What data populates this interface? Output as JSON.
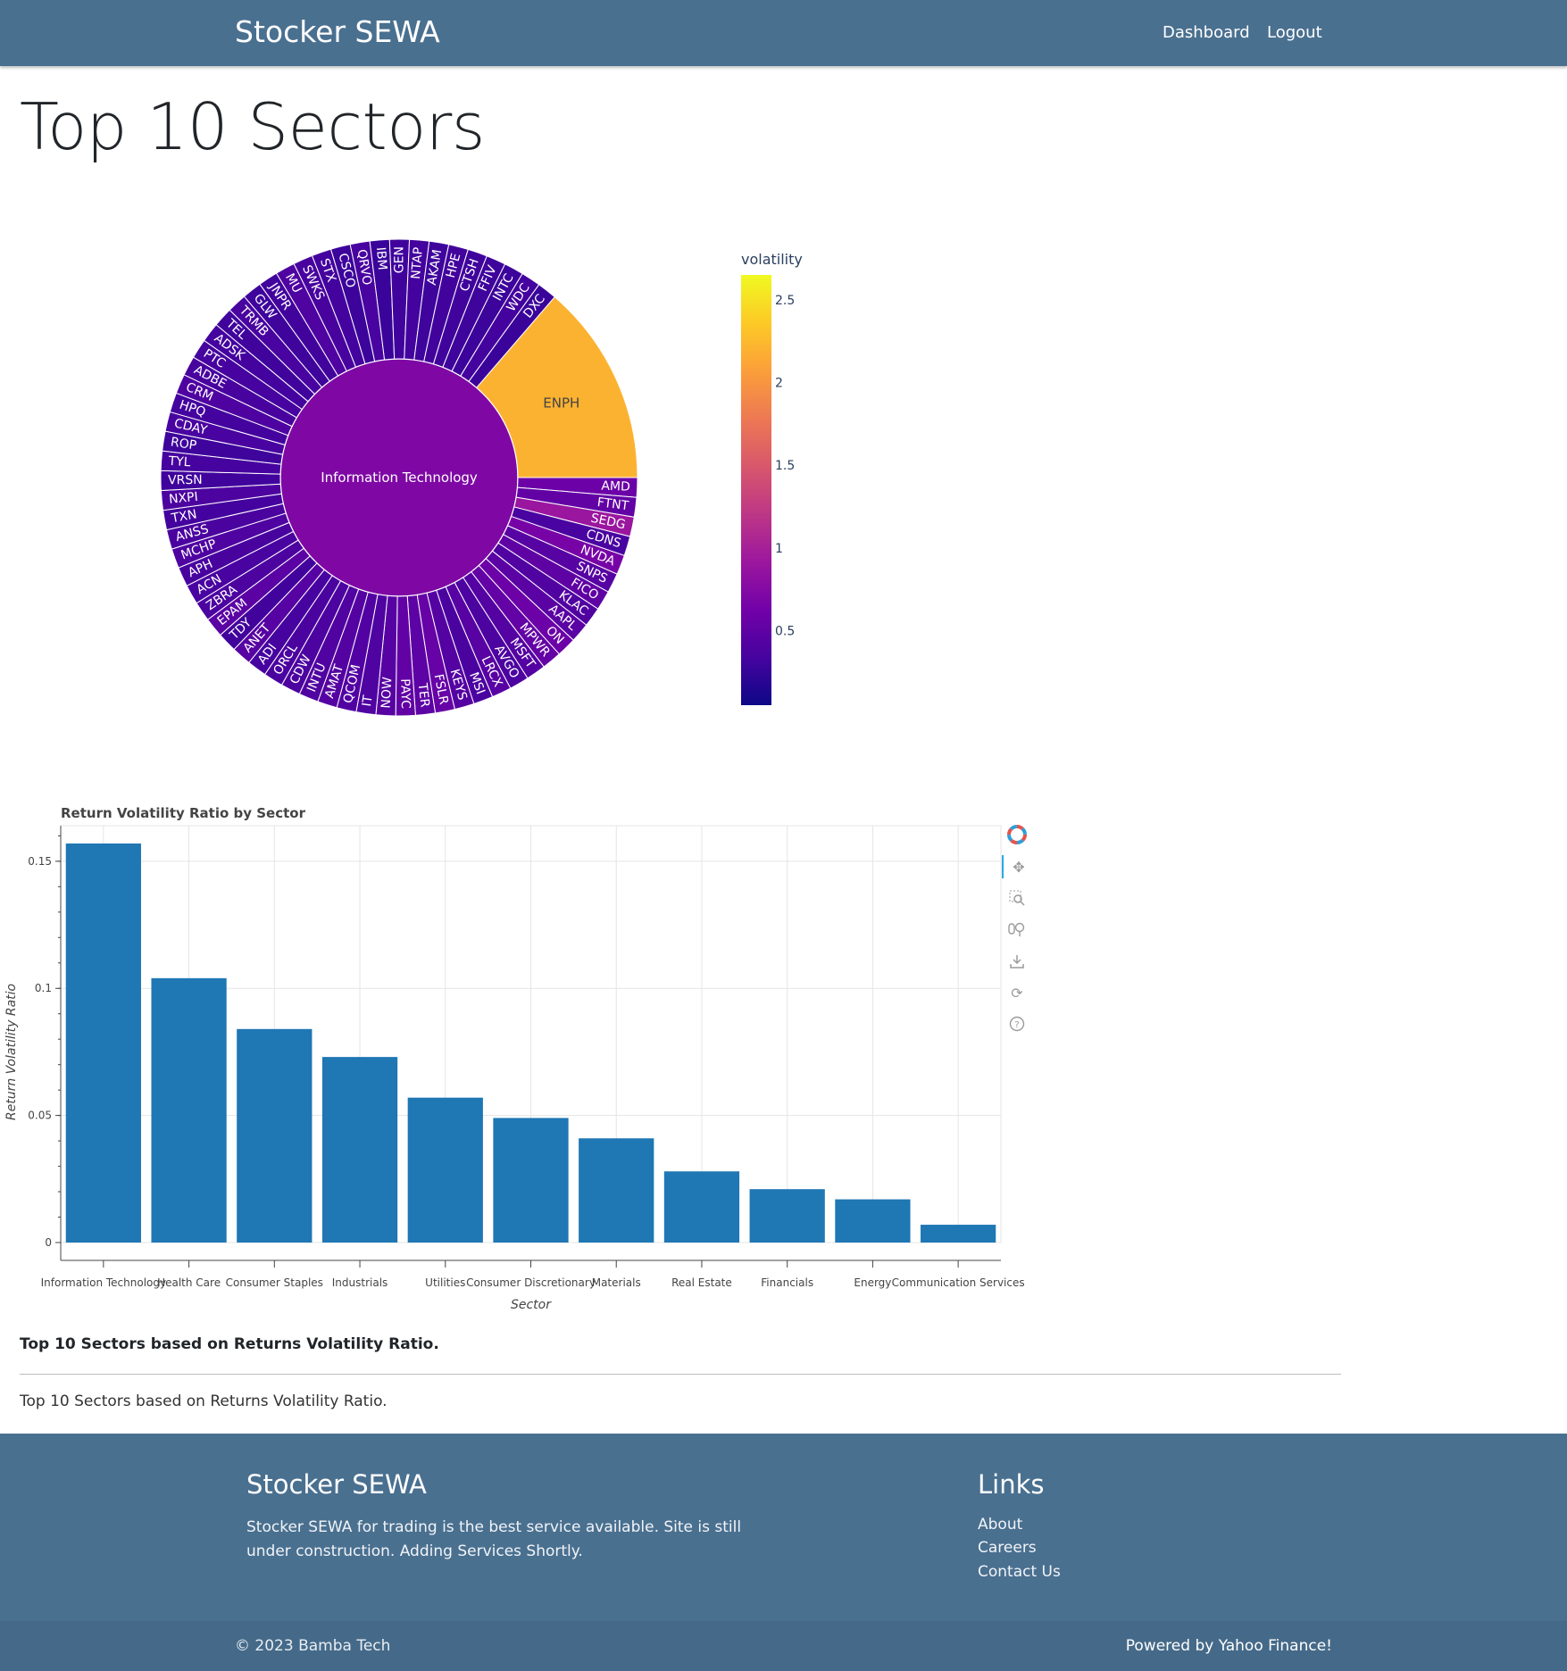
{
  "navbar": {
    "brand": "Stocker SEWA",
    "links": [
      "Dashboard",
      "Logout"
    ]
  },
  "page": {
    "title": "Top 10 Sectors",
    "caption_bold": "Top 10 Sectors based on Returns Volatility Ratio.",
    "caption": "Top 10 Sectors based on Returns Volatility Ratio."
  },
  "chart_data": [
    {
      "type": "sunburst",
      "title": "",
      "center": {
        "label": "Information Technology",
        "volatility": 0.72
      },
      "colorbar": {
        "title": "volatility",
        "ticks": [
          0.5,
          1,
          1.5,
          2,
          2.5
        ],
        "range": [
          0.05,
          2.65
        ],
        "colorscale": "plasma"
      },
      "segments": [
        {
          "label": "ENPH",
          "volatility": 2.2
        },
        {
          "label": "AMD",
          "volatility": 0.58
        },
        {
          "label": "FTNT",
          "volatility": 0.52
        },
        {
          "label": "SEDG",
          "volatility": 0.9
        },
        {
          "label": "CDNS",
          "volatility": 0.36
        },
        {
          "label": "NVDA",
          "volatility": 0.66
        },
        {
          "label": "SNPS",
          "volatility": 0.45
        },
        {
          "label": "FICO",
          "volatility": 0.5
        },
        {
          "label": "KLAC",
          "volatility": 0.41
        },
        {
          "label": "AAPL",
          "volatility": 0.47
        },
        {
          "label": "ON",
          "volatility": 0.58
        },
        {
          "label": "MPWR",
          "volatility": 0.53
        },
        {
          "label": "MSFT",
          "volatility": 0.43
        },
        {
          "label": "AVGO",
          "volatility": 0.38
        },
        {
          "label": "LRCX",
          "volatility": 0.46
        },
        {
          "label": "MSI",
          "volatility": 0.37
        },
        {
          "label": "KEYS",
          "volatility": 0.44
        },
        {
          "label": "FSLR",
          "volatility": 0.55
        },
        {
          "label": "TER",
          "volatility": 0.49
        },
        {
          "label": "PAYC",
          "volatility": 0.52
        },
        {
          "label": "NOW",
          "volatility": 0.45
        },
        {
          "label": "IT",
          "volatility": 0.4
        },
        {
          "label": "QCOM",
          "volatility": 0.42
        },
        {
          "label": "AMAT",
          "volatility": 0.44
        },
        {
          "label": "INTU",
          "volatility": 0.41
        },
        {
          "label": "CDW",
          "volatility": 0.38
        },
        {
          "label": "ORCL",
          "volatility": 0.37
        },
        {
          "label": "ADI",
          "volatility": 0.34
        },
        {
          "label": "ANET",
          "volatility": 0.45
        },
        {
          "label": "TDY",
          "volatility": 0.32
        },
        {
          "label": "EPAM",
          "volatility": 0.47
        },
        {
          "label": "ZBRA",
          "volatility": 0.38
        },
        {
          "label": "ACN",
          "volatility": 0.36
        },
        {
          "label": "APH",
          "volatility": 0.35
        },
        {
          "label": "MCHP",
          "volatility": 0.4
        },
        {
          "label": "ANSS",
          "volatility": 0.37
        },
        {
          "label": "TXN",
          "volatility": 0.33
        },
        {
          "label": "NXPI",
          "volatility": 0.38
        },
        {
          "label": "VRSN",
          "volatility": 0.31
        },
        {
          "label": "TYL",
          "volatility": 0.34
        },
        {
          "label": "ROP",
          "volatility": 0.3
        },
        {
          "label": "CDAY",
          "volatility": 0.36
        },
        {
          "label": "HPQ",
          "volatility": 0.33
        },
        {
          "label": "CRM",
          "volatility": 0.39
        },
        {
          "label": "ADBE",
          "volatility": 0.35
        },
        {
          "label": "PTC",
          "volatility": 0.34
        },
        {
          "label": "ADSK",
          "volatility": 0.33
        },
        {
          "label": "TEL",
          "volatility": 0.31
        },
        {
          "label": "TRMB",
          "volatility": 0.36
        },
        {
          "label": "GLW",
          "volatility": 0.3
        },
        {
          "label": "JNPR",
          "volatility": 0.32
        },
        {
          "label": "MU",
          "volatility": 0.4
        },
        {
          "label": "SWKS",
          "volatility": 0.35
        },
        {
          "label": "STX",
          "volatility": 0.33
        },
        {
          "label": "CSCO",
          "volatility": 0.29
        },
        {
          "label": "QRVO",
          "volatility": 0.36
        },
        {
          "label": "IBM",
          "volatility": 0.28
        },
        {
          "label": "GEN",
          "volatility": 0.31
        },
        {
          "label": "NTAP",
          "volatility": 0.33
        },
        {
          "label": "AKAM",
          "volatility": 0.3
        },
        {
          "label": "HPE",
          "volatility": 0.32
        },
        {
          "label": "CTSH",
          "volatility": 0.31
        },
        {
          "label": "FFIV",
          "volatility": 0.3
        },
        {
          "label": "INTC",
          "volatility": 0.29
        },
        {
          "label": "WDC",
          "volatility": 0.33
        },
        {
          "label": "DXC",
          "volatility": 0.28
        }
      ]
    },
    {
      "type": "bar",
      "title": "Return Volatility Ratio by Sector",
      "xlabel": "Sector",
      "ylabel": "Return Volatility Ratio",
      "categories": [
        "Information Technology",
        "Health Care",
        "Consumer Staples",
        "Industrials",
        "Utilities",
        "Consumer Discretionary",
        "Materials",
        "Real Estate",
        "Financials",
        "Energy",
        "Communication Services"
      ],
      "values": [
        0.157,
        0.104,
        0.084,
        0.073,
        0.057,
        0.049,
        0.041,
        0.028,
        0.021,
        0.017,
        0.007
      ],
      "yticks": [
        "0",
        "0.05",
        "0.1",
        "0.15"
      ],
      "ylim": [
        0,
        0.164
      ],
      "grid": true,
      "bar_color": "#1f77b4"
    }
  ],
  "toolbar": {
    "tools": [
      "bokeh-logo-icon",
      "pan-icon",
      "box-zoom-icon",
      "wheel-zoom-icon",
      "save-icon",
      "reset-icon",
      "help-icon"
    ]
  },
  "footer": {
    "title": "Stocker SEWA",
    "description": "Stocker SEWA for trading is the best service available. Site is still under construction. Adding Services Shortly.",
    "links_title": "Links",
    "links": [
      "About",
      "Careers",
      "Contact Us"
    ],
    "copyright": "© 2023 Bamba Tech",
    "powered": "Powered by Yahoo Finance!"
  }
}
